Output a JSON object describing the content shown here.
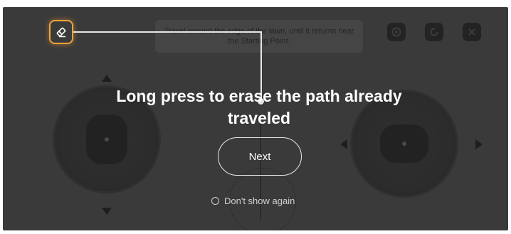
{
  "hint": {
    "text": "Travel around the edge of the lawn, until it returns near the Starting Point."
  },
  "toolbar": {
    "buttons": [
      {
        "name": "eye-icon"
      },
      {
        "name": "undo-icon"
      },
      {
        "name": "close-icon"
      }
    ],
    "eraser_icon": "eraser-icon"
  },
  "guide": {
    "title": "Long press to erase the path already traveled",
    "next_label": "Next",
    "dont_show_label": "Don't show again",
    "accent_color": "#f0a23b"
  }
}
